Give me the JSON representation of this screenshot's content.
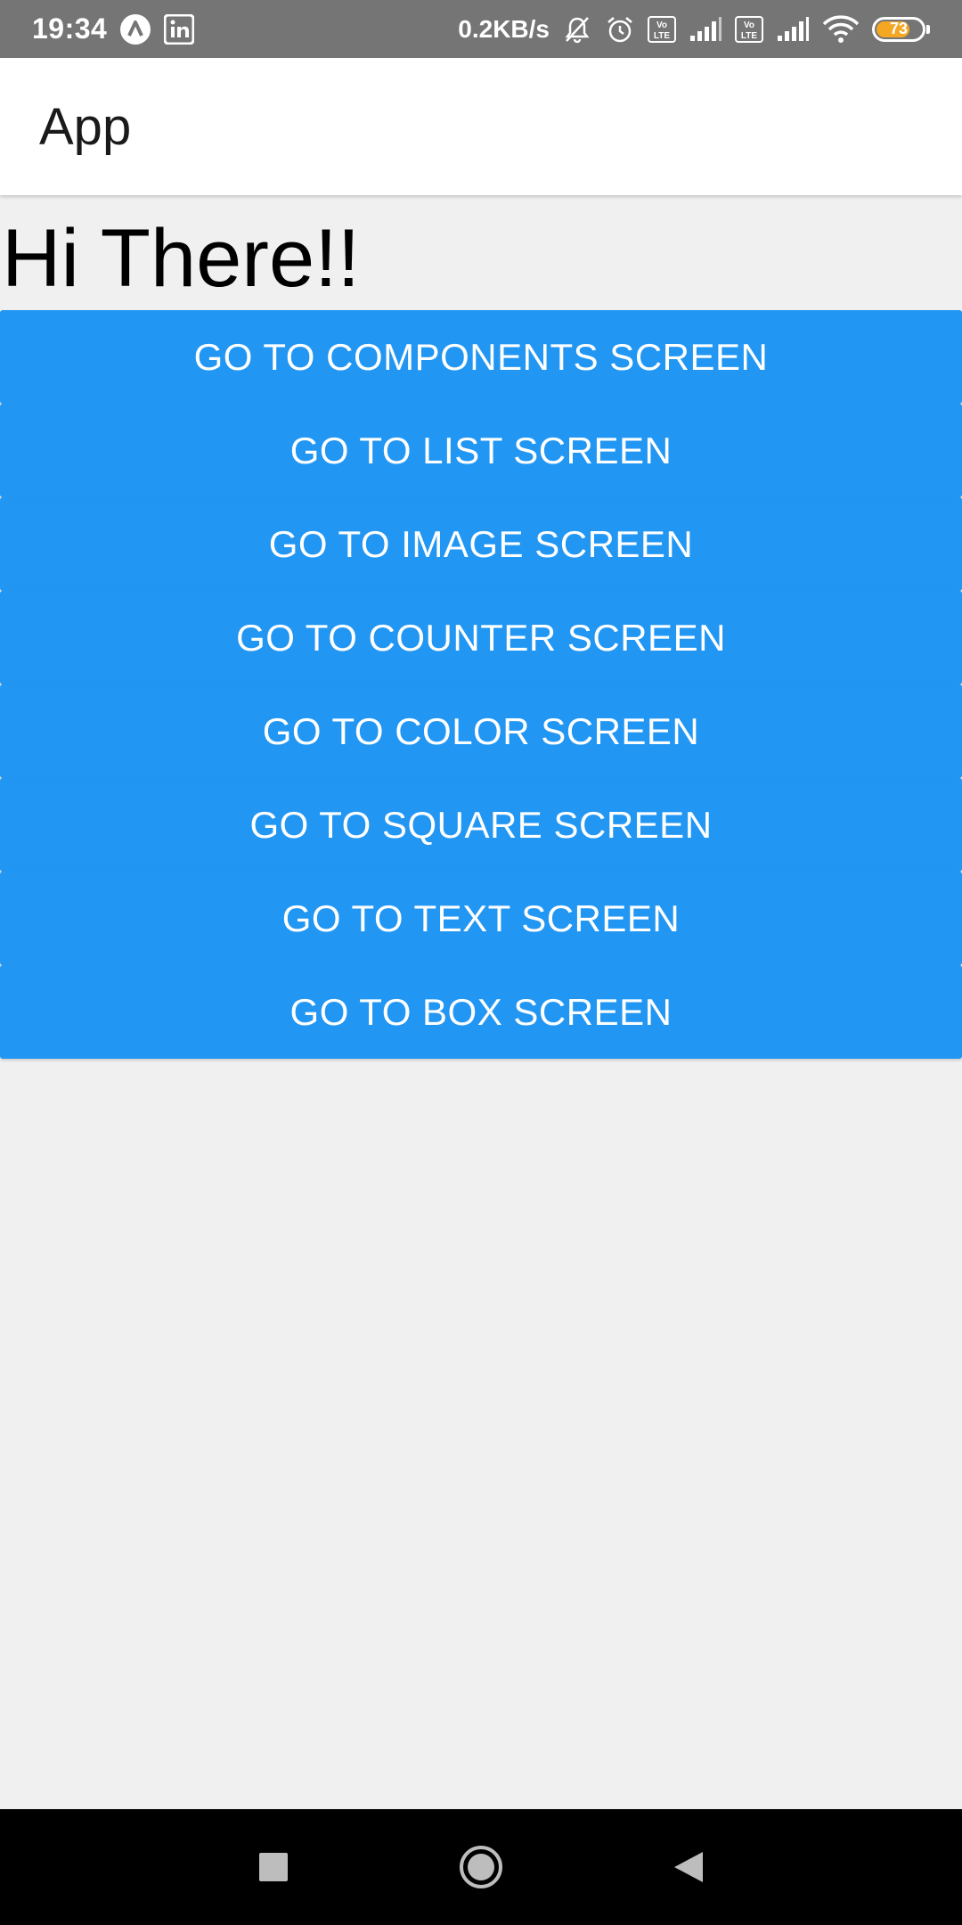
{
  "status_bar": {
    "time": "19:34",
    "network_speed": "0.2KB/s",
    "battery_level": "73",
    "battery_fraction": 0.73,
    "battery_color": "#f5a623",
    "icons": [
      "assistant-icon",
      "linkedin-icon",
      "mute-icon",
      "alarm-icon",
      "volte-icon",
      "signal-icon",
      "volte-icon",
      "signal-icon",
      "wifi-icon",
      "battery-icon"
    ]
  },
  "app_bar": {
    "title": "App"
  },
  "main": {
    "greeting": "Hi There!!",
    "button_color": "#2196f3",
    "buttons": [
      {
        "label": "GO TO COMPONENTS SCREEN"
      },
      {
        "label": "GO TO LIST SCREEN"
      },
      {
        "label": "GO TO IMAGE SCREEN"
      },
      {
        "label": "GO TO COUNTER SCREEN"
      },
      {
        "label": "GO TO COLOR SCREEN"
      },
      {
        "label": "GO TO SQUARE SCREEN"
      },
      {
        "label": "GO TO TEXT SCREEN"
      },
      {
        "label": "GO TO BOX SCREEN"
      }
    ]
  },
  "nav_bar": {
    "keys": [
      "recents-icon",
      "home-icon",
      "back-icon"
    ]
  }
}
